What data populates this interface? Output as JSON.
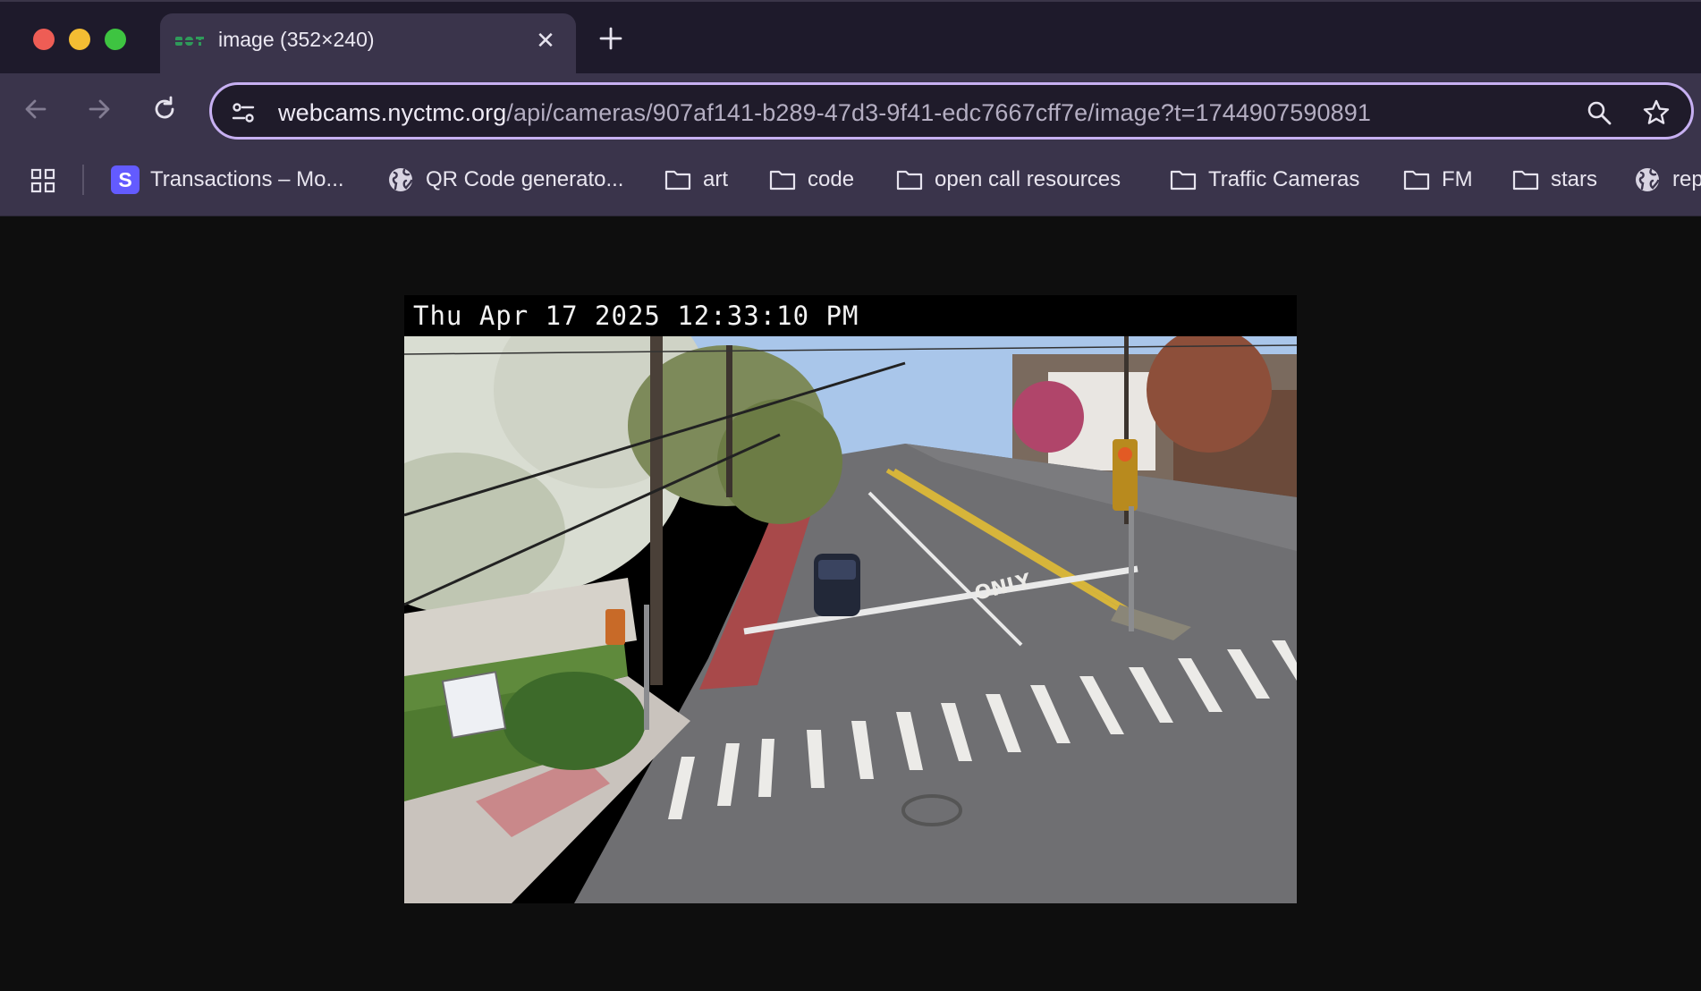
{
  "window": {
    "controls": [
      "close",
      "minimize",
      "zoom"
    ]
  },
  "tab": {
    "title": "image (352×240)",
    "favicon": "nyc-dot-favicon",
    "close_icon": "close-icon",
    "new_tab_icon": "plus-icon"
  },
  "toolbar": {
    "back_icon": "arrow-left-icon",
    "forward_icon": "arrow-right-icon",
    "reload_icon": "reload-icon",
    "url_domain": "webcams.nyctmc.org",
    "url_path": "/api/cameras/907af141-b289-47d3-9f41-edc7667cff7e/image?t=1744907590891",
    "site_info_icon": "tune-icon",
    "zoom_icon": "magnifier-icon",
    "bookmark_star_icon": "star-icon"
  },
  "bookmarks": {
    "apps_icon": "grid-icon",
    "items": [
      {
        "label": "Transactions – Mo...",
        "icon": "stripe-s-icon",
        "badge": "S"
      },
      {
        "label": "QR Code generato...",
        "icon": "globe-icon"
      },
      {
        "label": "art",
        "icon": "folder-icon"
      },
      {
        "label": "code",
        "icon": "folder-icon"
      },
      {
        "label": "open call resources",
        "icon": "folder-icon"
      },
      {
        "label": "Traffic Cameras",
        "icon": "folder-icon"
      },
      {
        "label": "FM",
        "icon": "folder-icon"
      },
      {
        "label": "stars",
        "icon": "folder-icon"
      },
      {
        "label": "rep",
        "icon": "globe-icon"
      }
    ]
  },
  "content": {
    "camera_timestamp": "Thu Apr 17 2025 12:33:10 PM",
    "road_marking": "ONLY"
  },
  "colors": {
    "tabstrip_bg": "#1e1a2b",
    "toolbar_bg": "#3a344b",
    "omnibox_border": "#c7b0f2",
    "page_bg": "#0e0e0e"
  }
}
